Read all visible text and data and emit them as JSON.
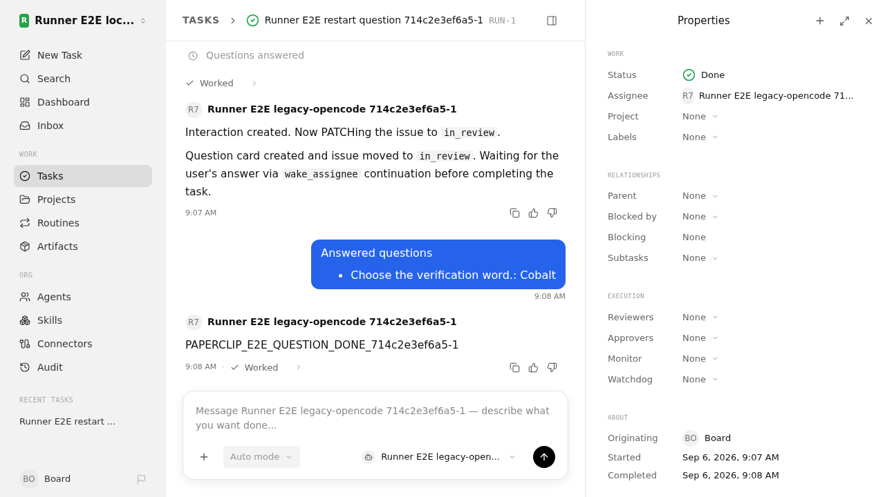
{
  "sidebar": {
    "workspace": {
      "initial": "R",
      "name": "Runner E2E loc..."
    },
    "top_items": [
      {
        "label": "New Task",
        "selected": false
      },
      {
        "label": "Search",
        "selected": false
      },
      {
        "label": "Dashboard",
        "selected": false
      },
      {
        "label": "Inbox",
        "selected": false
      }
    ],
    "sections": [
      {
        "heading": "WORK",
        "items": [
          {
            "label": "Tasks",
            "selected": true
          },
          {
            "label": "Projects",
            "selected": false
          },
          {
            "label": "Routines",
            "selected": false
          },
          {
            "label": "Artifacts",
            "selected": false
          }
        ]
      },
      {
        "heading": "ORG",
        "items": [
          {
            "label": "Agents",
            "selected": false
          },
          {
            "label": "Skills",
            "selected": false
          },
          {
            "label": "Connectors",
            "selected": false
          },
          {
            "label": "Audit",
            "selected": false
          }
        ]
      }
    ],
    "recent": {
      "heading": "RECENT TASKS",
      "items": [
        "Runner E2E restart ..."
      ]
    },
    "user": {
      "initials": "BO",
      "name": "Board"
    }
  },
  "header": {
    "breadcrumb": "TASKS",
    "title": "Runner E2E restart question 714c2e3ef6a5-1",
    "run_id": "RUN-1"
  },
  "conversation": [
    {
      "kind": "event",
      "text": "Questions answered"
    },
    {
      "kind": "worked",
      "text": "Worked"
    },
    {
      "kind": "agent",
      "initials": "R7",
      "author": "Runner E2E legacy-opencode 714c2e3ef6a5-1",
      "paragraphs": [
        [
          {
            "kind": "text",
            "text": "Interaction created. Now PATCHing the issue to "
          },
          {
            "kind": "code",
            "text": "in_review"
          },
          {
            "kind": "text",
            "text": "."
          }
        ],
        [
          {
            "kind": "text",
            "text": "Question card created and issue moved to "
          },
          {
            "kind": "code",
            "text": "in_review"
          },
          {
            "kind": "text",
            "text": ". Waiting for the user's answer via "
          },
          {
            "kind": "code",
            "text": "wake_assignee"
          },
          {
            "kind": "text",
            "text": " continuation before completing the task."
          }
        ]
      ],
      "time": "9:07 AM"
    },
    {
      "kind": "user",
      "title": "Answered questions",
      "bullets": [
        "Choose the verification word.: Cobalt"
      ],
      "time": "9:08 AM"
    },
    {
      "kind": "agent",
      "initials": "R7",
      "author": "Runner E2E legacy-opencode 714c2e3ef6a5-1",
      "paragraphs": [
        [
          {
            "kind": "text",
            "text": "PAPERCLIP_E2E_QUESTION_DONE_714c2e3ef6a5-1"
          }
        ]
      ],
      "time": "9:08 AM",
      "separator": "·",
      "worked": "Worked"
    }
  ],
  "composer": {
    "placeholder": "Message Runner E2E legacy-opencode 714c2e3ef6a5-1 — describe what you want done...",
    "mode": "Auto mode",
    "agent": "Runner E2E legacy-open..."
  },
  "properties": {
    "title": "Properties",
    "sections": [
      {
        "heading": "WORK",
        "rows": [
          {
            "label": "Status",
            "kind": "status",
            "value": "Done"
          },
          {
            "label": "Assignee",
            "kind": "person",
            "initials": "R7",
            "value": "Runner E2E legacy-opencode 71...",
            "link": true
          },
          {
            "label": "Project",
            "kind": "select",
            "value": "None"
          },
          {
            "label": "Labels",
            "kind": "select",
            "value": "None"
          }
        ]
      },
      {
        "heading": "RELATIONSHIPS",
        "rows": [
          {
            "label": "Parent",
            "kind": "select",
            "value": "None"
          },
          {
            "label": "Blocked by",
            "kind": "select",
            "value": "None"
          },
          {
            "label": "Blocking",
            "kind": "plain",
            "value": "None"
          },
          {
            "label": "Subtasks",
            "kind": "select",
            "value": "None"
          }
        ]
      },
      {
        "heading": "EXECUTION",
        "rows": [
          {
            "label": "Reviewers",
            "kind": "select",
            "value": "None"
          },
          {
            "label": "Approvers",
            "kind": "select",
            "value": "None"
          },
          {
            "label": "Monitor",
            "kind": "select",
            "value": "None"
          },
          {
            "label": "Watchdog",
            "kind": "select",
            "value": "None"
          }
        ]
      },
      {
        "heading": "ABOUT",
        "rows": [
          {
            "label": "Originating",
            "kind": "person",
            "initials": "BO",
            "value": "Board",
            "link": false
          },
          {
            "label": "Started",
            "kind": "date",
            "value": "Sep 6, 2026, 9:07 AM"
          },
          {
            "label": "Completed",
            "kind": "date",
            "value": "Sep 6, 2026, 9:08 AM"
          }
        ]
      }
    ]
  }
}
